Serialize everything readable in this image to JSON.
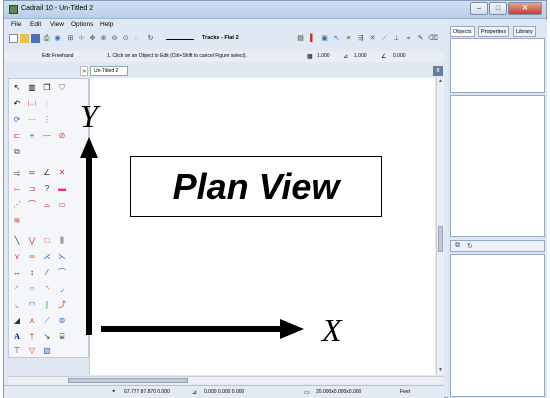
{
  "window": {
    "title": "Cadrail 10 - Un-Titled 2",
    "controls": {
      "minimize": "–",
      "maximize": "□",
      "close": "✕"
    }
  },
  "menu": {
    "items": [
      "File",
      "Edit",
      "View",
      "Options",
      "Help"
    ]
  },
  "toolbar": {
    "icons": [
      "new-file-icon",
      "open-folder-icon",
      "save-icon",
      "print-icon",
      "properties-icon",
      "grid-icon",
      "pan-icon",
      "zoom-in-icon",
      "zoom-out-icon",
      "zoom-window-icon",
      "zoom-extents-icon"
    ],
    "line_style": "Tracks - Flat 2"
  },
  "status": {
    "mode": "Edit Freehand",
    "hint": "1. Click on an Object to Edit (Ctrl+Shift to cancel Figure select).",
    "value1": "1.000",
    "value2": "1.000",
    "value3": "0.000"
  },
  "doc_tabs": {
    "scroll": ">",
    "active": "Un-Titled 2",
    "close": "x"
  },
  "canvas": {
    "plan_title": "Plan View",
    "axis_y": "Y",
    "axis_x": "X"
  },
  "coords": {
    "cursor": "67.777  87.870  0.000",
    "delta": "0.000  0.000  0.000",
    "extents": "20.000x0.000x0.000",
    "units": "Feet"
  },
  "right_panel": {
    "tabs": [
      "Objects",
      "Properties",
      "Library"
    ]
  }
}
